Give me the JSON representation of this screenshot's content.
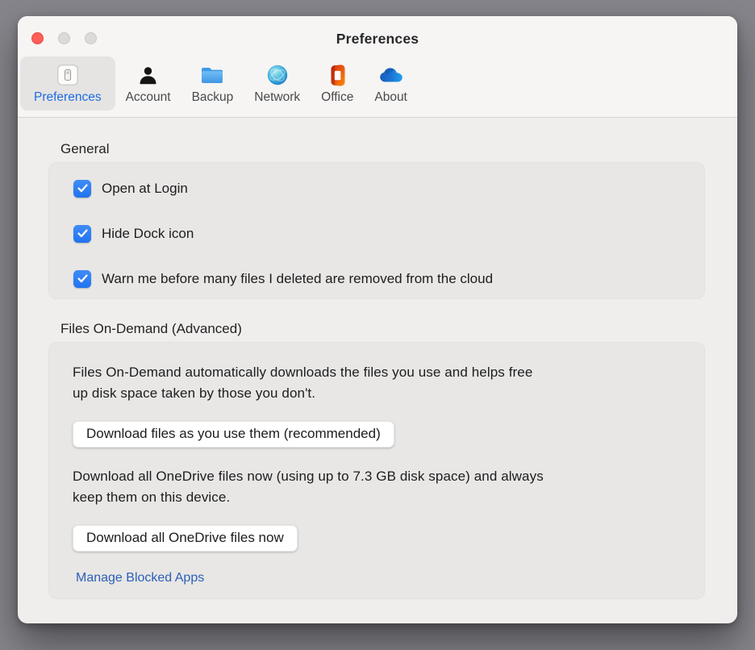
{
  "window": {
    "title": "Preferences",
    "desktop_color": "#85858b",
    "titlebar_color": "#f6f5f4",
    "content_color": "#efeeec",
    "traffic_red": "#ff5e57"
  },
  "toolbar": {
    "selected_tab_text_color": "#1e6ce6",
    "tabs": [
      {
        "label": "Preferences",
        "icon": "switch-icon",
        "selected": true
      },
      {
        "label": "Account",
        "icon": "person-icon",
        "selected": false
      },
      {
        "label": "Backup",
        "icon": "folder-icon",
        "selected": false
      },
      {
        "label": "Network",
        "icon": "globe-icon",
        "selected": false
      },
      {
        "label": "Office",
        "icon": "office-icon",
        "selected": false
      },
      {
        "label": "About",
        "icon": "onedrive-cloud-icon",
        "selected": false
      }
    ]
  },
  "general": {
    "heading": "General",
    "checkbox_color": "#2f7cf3",
    "checkboxes": [
      {
        "label": "Open at Login",
        "checked": true
      },
      {
        "label": "Hide Dock icon",
        "checked": true
      },
      {
        "label": "Warn me before many files I deleted are removed from the cloud",
        "checked": true
      }
    ]
  },
  "files_on_demand": {
    "heading": "Files On-Demand (Advanced)",
    "description_1": "Files On-Demand automatically downloads the files you use and helps free\nup disk space taken by those you don't.",
    "button_1": "Download files as you use them (recommended)",
    "description_2": "Download all OneDrive files now (using up to 7.3 GB disk space) and always\nkeep them on this device.",
    "button_2": "Download all OneDrive files now",
    "link": "Manage Blocked Apps",
    "link_color": "#2b5fb7"
  }
}
